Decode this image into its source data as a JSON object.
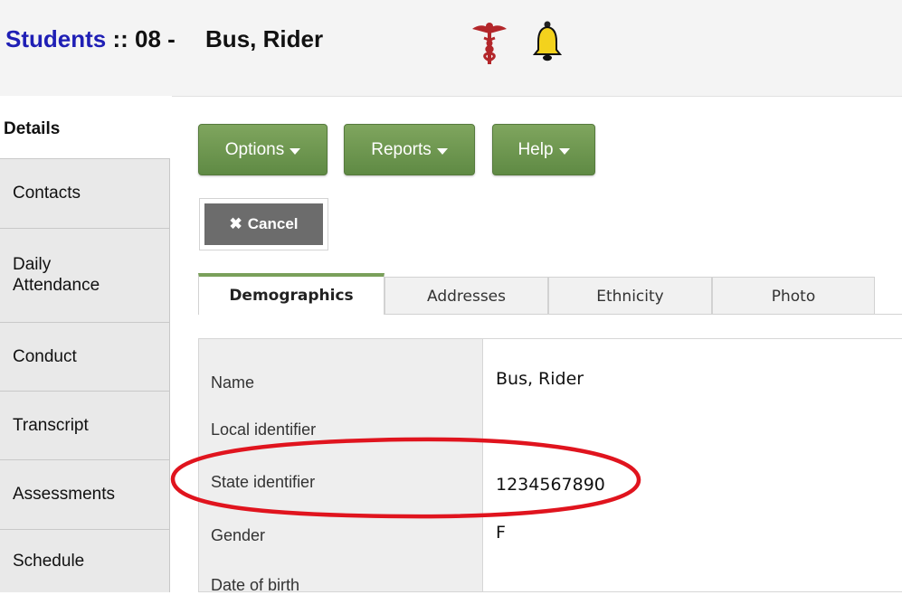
{
  "header": {
    "crumb": "Students",
    "separator": " :: 08 - ",
    "student_name": "Bus, Rider"
  },
  "icons": {
    "medical": "caduceus-icon",
    "alert": "bell-icon"
  },
  "sidebar": {
    "items": [
      {
        "label": "Details",
        "active": true
      },
      {
        "label": "Contacts"
      },
      {
        "label": "Daily Attendance"
      },
      {
        "label": "Conduct"
      },
      {
        "label": "Transcript"
      },
      {
        "label": "Assessments"
      },
      {
        "label": "Schedule"
      }
    ]
  },
  "toolbar": {
    "options_label": "Options",
    "reports_label": "Reports",
    "help_label": "Help",
    "cancel_label": "Cancel"
  },
  "tabs": [
    {
      "label": "Demographics",
      "active": true
    },
    {
      "label": "Addresses"
    },
    {
      "label": "Ethnicity"
    },
    {
      "label": "Photo"
    }
  ],
  "fields": [
    {
      "label": "Name",
      "value": "Bus, Rider"
    },
    {
      "label": "Local identifier",
      "value": ""
    },
    {
      "label": "State identifier",
      "value": "1234567890"
    },
    {
      "label": "Gender",
      "value": "F"
    },
    {
      "label": "Date of birth",
      "value": ""
    }
  ],
  "colors": {
    "crumb": "#1f1fb5",
    "button_green": "#6f9850",
    "tab_active_border": "#7aa05a",
    "annotation": "#e0141e"
  }
}
